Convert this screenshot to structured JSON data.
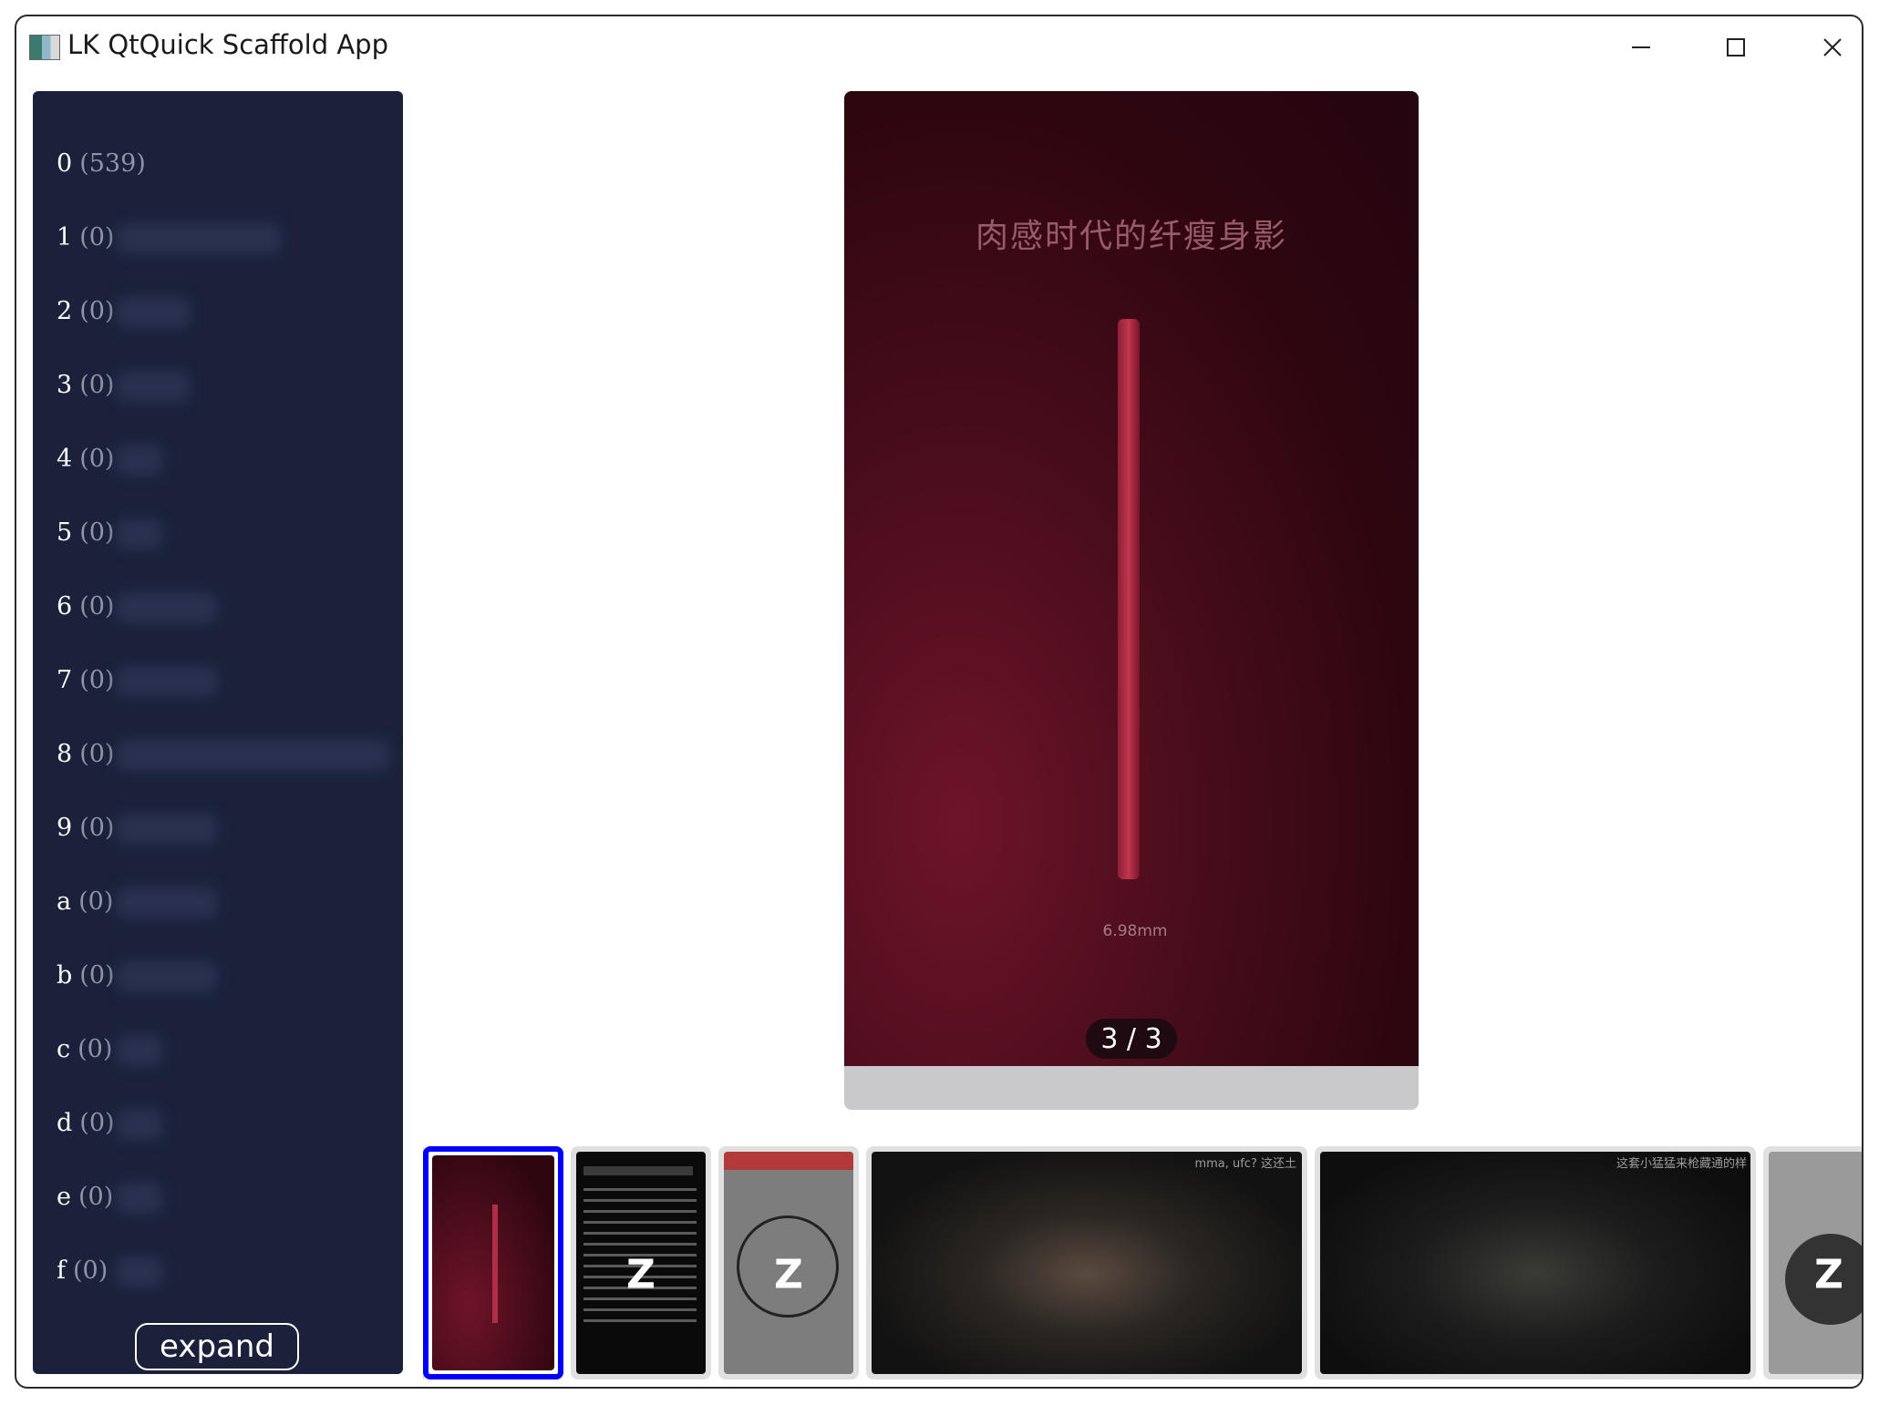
{
  "window": {
    "title": "LK QtQuick Scaffold App"
  },
  "titlebar": {
    "icons": [
      "app-icon",
      "minimize-icon",
      "maximize-icon",
      "close-icon"
    ]
  },
  "sidebar": {
    "items": [
      {
        "key": "0",
        "count": "(539)"
      },
      {
        "key": "1",
        "count": "(0)"
      },
      {
        "key": "2",
        "count": "(0)"
      },
      {
        "key": "3",
        "count": "(0)"
      },
      {
        "key": "4",
        "count": "(0)"
      },
      {
        "key": "5",
        "count": "(0)"
      },
      {
        "key": "6",
        "count": "(0)"
      },
      {
        "key": "7",
        "count": "(0)"
      },
      {
        "key": "8",
        "count": "(0)"
      },
      {
        "key": "9",
        "count": "(0)"
      },
      {
        "key": "a",
        "count": "(0)"
      },
      {
        "key": "b",
        "count": "(0)"
      },
      {
        "key": "c",
        "count": "(0)"
      },
      {
        "key": "d",
        "count": "(0)"
      },
      {
        "key": "e",
        "count": "(0)"
      },
      {
        "key": "f",
        "count": "(0)"
      }
    ],
    "expand_label": "expand"
  },
  "viewer": {
    "caption": "肉感时代的纤瘦身影",
    "thickness": "6.98mm",
    "page_counter": "3 / 3"
  },
  "thumbnails": [
    {
      "selected": true,
      "z": "",
      "overlay": ""
    },
    {
      "selected": false,
      "z": "Z",
      "overlay": ""
    },
    {
      "selected": false,
      "z": "Z",
      "overlay": ""
    },
    {
      "selected": false,
      "z": "",
      "overlay": "mma, ufc?    这还土"
    },
    {
      "selected": false,
      "z": "",
      "overlay": "这套小猛猛来枪藏通的样"
    },
    {
      "selected": false,
      "z": "Z",
      "overlay": ""
    }
  ],
  "colors": {
    "sidebar_bg": "#1b213a",
    "selected_border": "#0000ff",
    "viewer_bg": "#3a0814"
  }
}
